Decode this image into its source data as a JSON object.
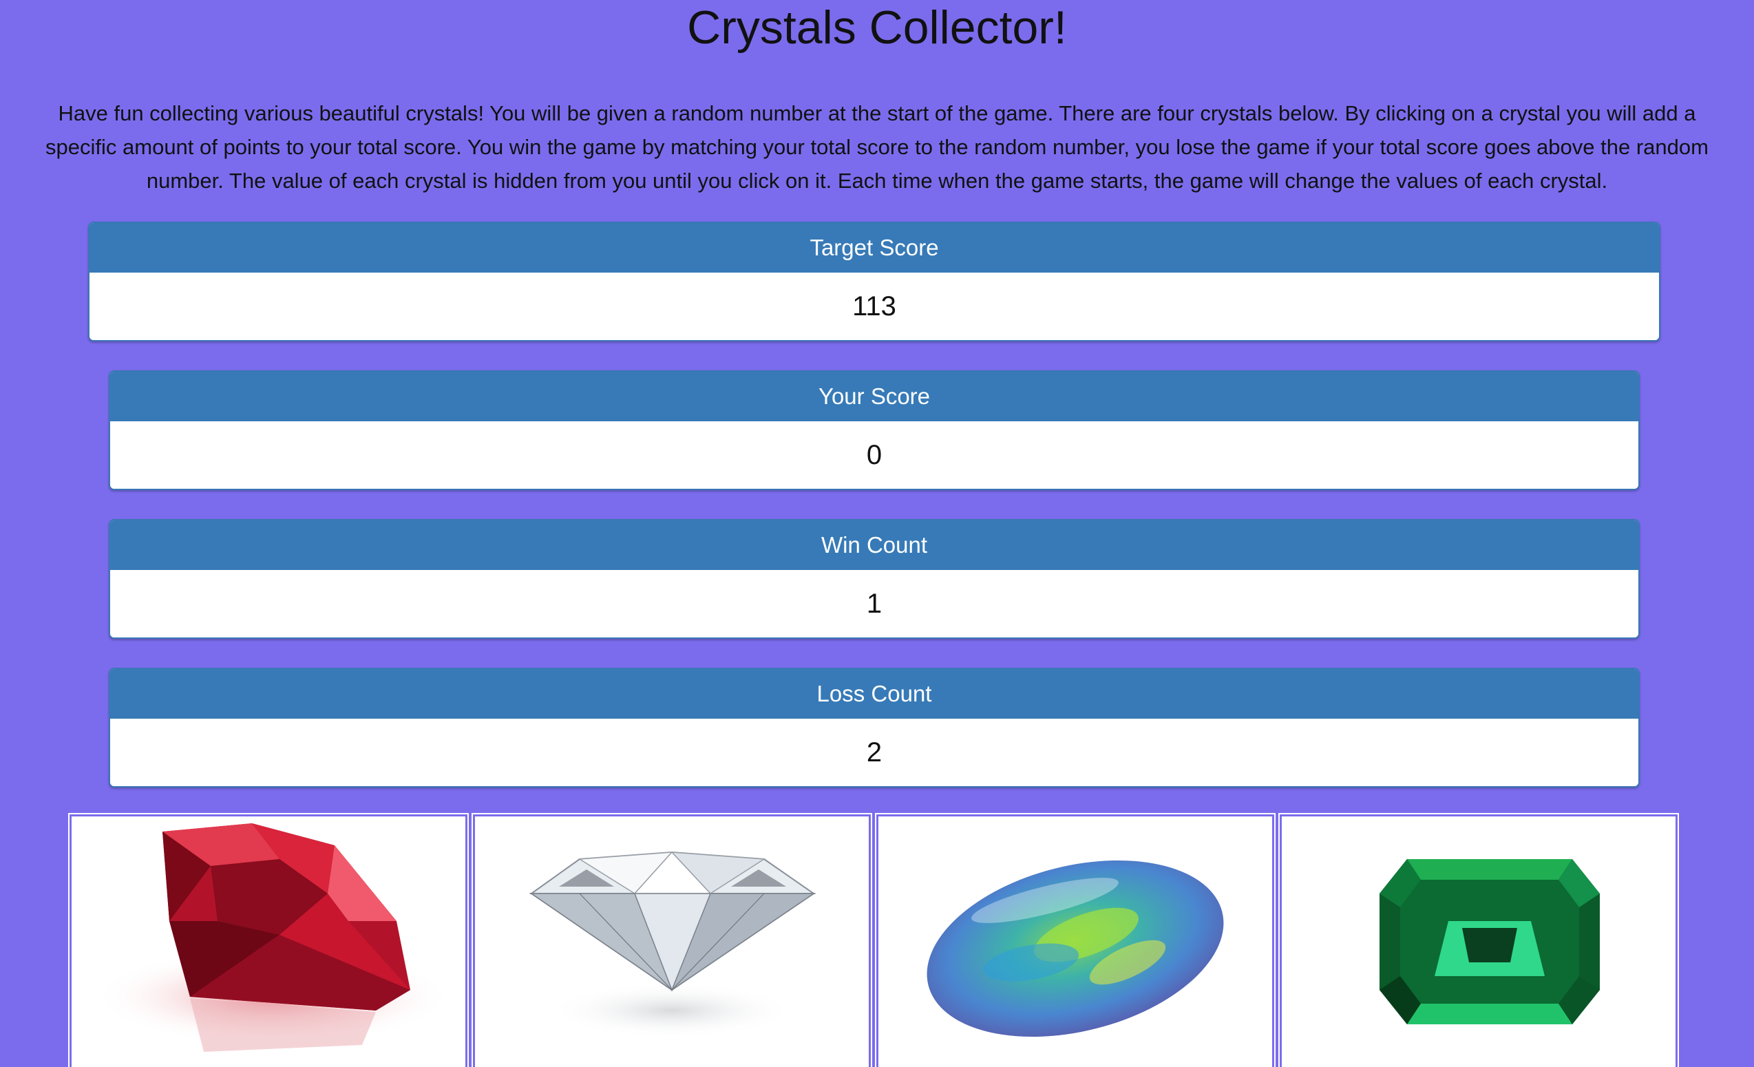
{
  "title": "Crystals Collector!",
  "intro": "Have fun collecting various beautiful crystals! You will be given a random number at the start of the game. There are four crystals below. By clicking on a crystal you will add a specific amount of points to your total score. You win the game by matching your total score to the random number, you lose the game if your total score goes above the random number. The value of each crystal is hidden from you until you click on it. Each time when the game starts, the game will change the values of each crystal.",
  "panels": {
    "target": {
      "label": "Target Score",
      "value": "113"
    },
    "score": {
      "label": "Your Score",
      "value": "0"
    },
    "wins": {
      "label": "Win Count",
      "value": "1"
    },
    "losses": {
      "label": "Loss Count",
      "value": "2"
    }
  },
  "crystals": [
    {
      "name": "ruby",
      "color": "#c0172b"
    },
    {
      "name": "diamond",
      "color": "#dfe6ee"
    },
    {
      "name": "opal",
      "color": "#5aa9d6"
    },
    {
      "name": "emerald",
      "color": "#0b8a3c"
    }
  ],
  "colors": {
    "background": "#7b6ced",
    "panel_header": "#377ab7",
    "panel_body": "#ffffff"
  }
}
